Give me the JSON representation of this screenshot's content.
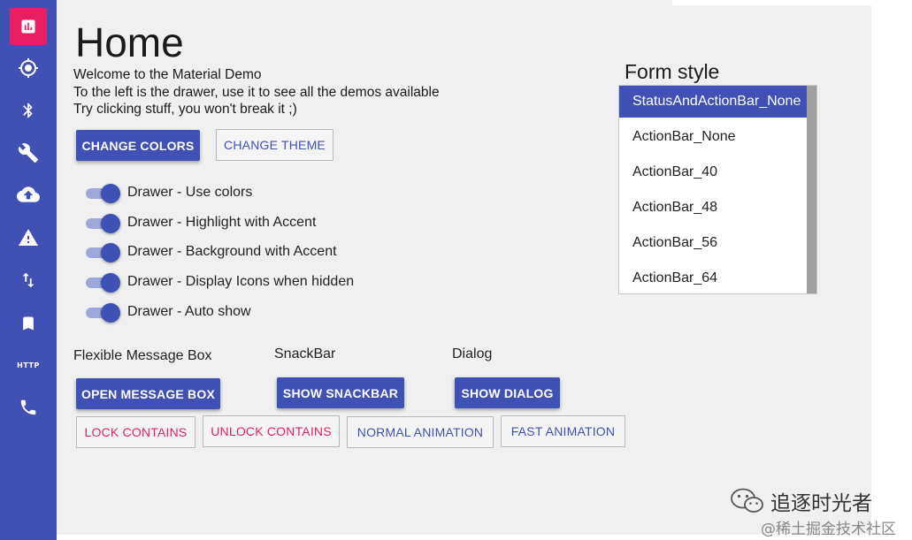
{
  "page": {
    "title": "Home",
    "welcome_lines": [
      "Welcome to the Material Demo",
      "To the left is the drawer, use it to see all the demos available",
      "Try clicking stuff, you won't break it ;)"
    ]
  },
  "drawer": {
    "items": [
      {
        "icon": "chart-icon",
        "active": true
      },
      {
        "icon": "gps-target-icon"
      },
      {
        "icon": "bluetooth-icon"
      },
      {
        "icon": "wrench-icon"
      },
      {
        "icon": "cloud-upload-icon"
      },
      {
        "icon": "warning-icon"
      },
      {
        "icon": "swap-vertical-icon"
      },
      {
        "icon": "bookmark-icon"
      },
      {
        "icon": "http-icon",
        "label": "HTTP"
      },
      {
        "icon": "phone-icon"
      }
    ],
    "color": "#3f51b5",
    "accent": "#e91e63"
  },
  "buttons": {
    "change_colors": "CHANGE COLORS",
    "change_theme": "CHANGE THEME",
    "open_message_box": "OPEN MESSAGE BOX",
    "show_snackbar": "SHOW SNACKBAR",
    "show_dialog": "SHOW DIALOG",
    "lock_contains": "LOCK CONTAINS",
    "unlock_contains": "UNLOCK CONTAINS",
    "normal_animation": "NORMAL ANIMATION",
    "fast_animation": "FAST ANIMATION"
  },
  "switches": [
    {
      "label": "Drawer - Use colors",
      "on": true
    },
    {
      "label": "Drawer - Highlight with Accent",
      "on": true
    },
    {
      "label": "Drawer - Background with Accent",
      "on": true
    },
    {
      "label": "Drawer - Display Icons when hidden",
      "on": true
    },
    {
      "label": "Drawer - Auto show",
      "on": true
    }
  ],
  "sections": {
    "message_box": "Flexible Message Box",
    "snackbar": "SnackBar",
    "dialog": "Dialog"
  },
  "form_style": {
    "title": "Form style",
    "items": [
      "StatusAndActionBar_None",
      "ActionBar_None",
      "ActionBar_40",
      "ActionBar_48",
      "ActionBar_56",
      "ActionBar_64"
    ],
    "selected": "StatusAndActionBar_None"
  },
  "watermark": {
    "line1": "追逐时光者",
    "line2": "@稀土掘金技术社区"
  }
}
